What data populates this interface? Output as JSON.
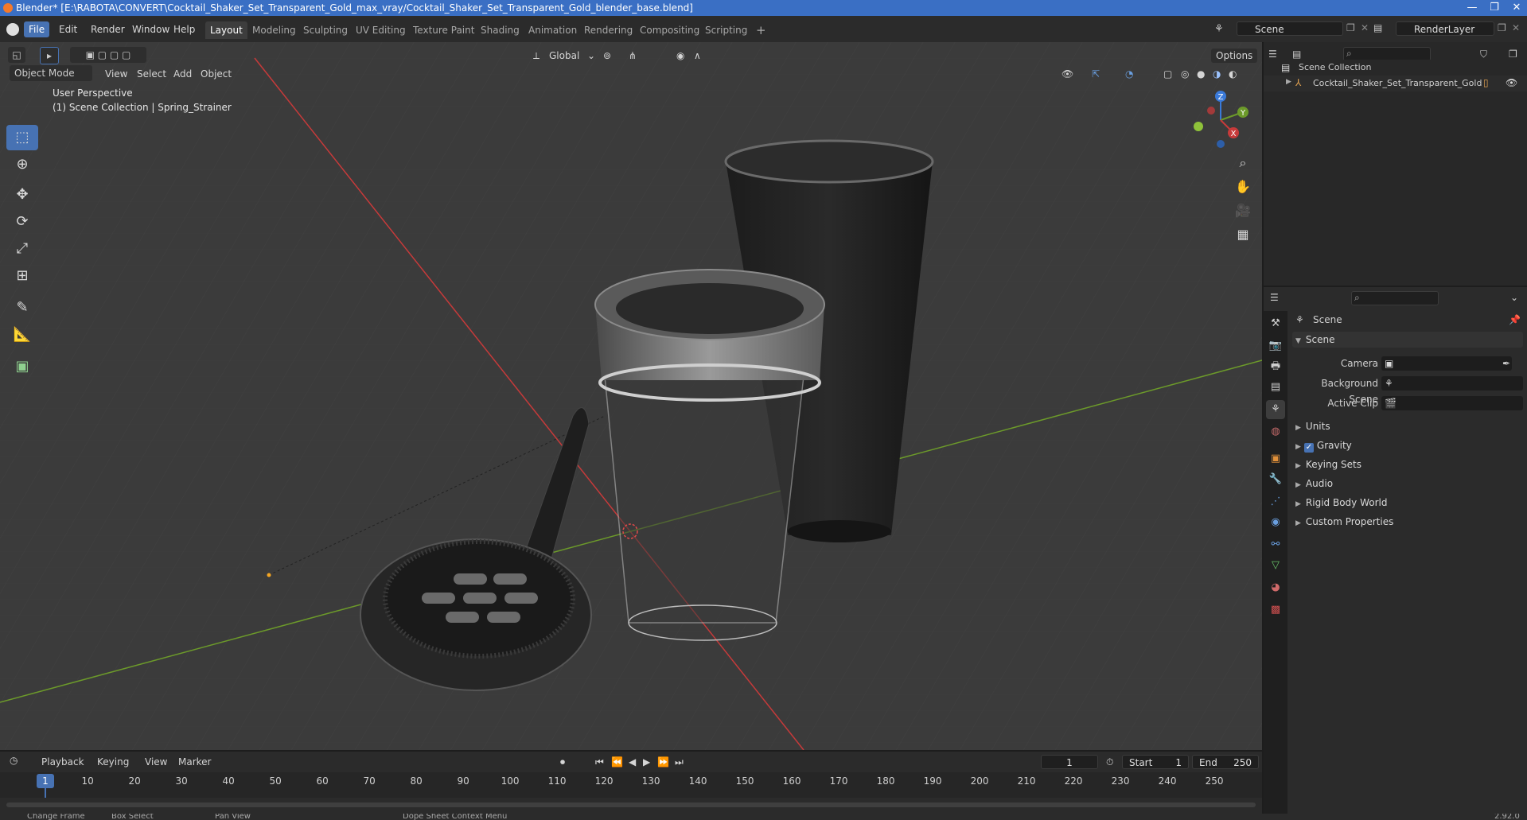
{
  "title_bar": {
    "text": "Blender* [E:\\RABOTA\\CONVERT\\Cocktail_Shaker_Set_Transparent_Gold_max_vray/Cocktail_Shaker_Set_Transparent_Gold_blender_base.blend]",
    "minimize": "—",
    "maximize": "❐",
    "close": "✕"
  },
  "menu": [
    "File",
    "Edit",
    "Render",
    "Window",
    "Help"
  ],
  "workspaces": [
    "Layout",
    "Modeling",
    "Sculpting",
    "UV Editing",
    "Texture Paint",
    "Shading",
    "Animation",
    "Rendering",
    "Compositing",
    "Scripting"
  ],
  "add_workspace": "+",
  "scene_field": "Scene",
  "renderlayer_field": "RenderLayer",
  "viewport": {
    "mode": "Object Mode",
    "menus": [
      "View",
      "Select",
      "Add",
      "Object"
    ],
    "transform_orientation": "Global",
    "options": "Options",
    "overlay_line1": "User Perspective",
    "overlay_line2": "(1) Scene Collection | Spring_Strainer",
    "gizmo_axes": {
      "x": "X",
      "y": "Y",
      "z": "Z"
    }
  },
  "outliner": {
    "root": "Scene Collection",
    "items": [
      "Cocktail_Shaker_Set_Transparent_Gold"
    ]
  },
  "properties": {
    "context": "Scene",
    "panel_title": "Scene",
    "fields": [
      {
        "label": "Camera",
        "value": ""
      },
      {
        "label": "Background Scene",
        "value": ""
      },
      {
        "label": "Active Clip",
        "value": ""
      }
    ],
    "sections": [
      "Units",
      "Gravity",
      "Keying Sets",
      "Audio",
      "Rigid Body World",
      "Custom Properties"
    ],
    "gravity_checked": true
  },
  "timeline": {
    "menus": [
      "Playback",
      "Keying",
      "View",
      "Marker"
    ],
    "current_frame": "1",
    "start_label": "Start",
    "start": "1",
    "end_label": "End",
    "end": "250",
    "ruler": [
      "1",
      "10",
      "20",
      "30",
      "40",
      "50",
      "60",
      "70",
      "80",
      "90",
      "100",
      "110",
      "120",
      "130",
      "140",
      "150",
      "160",
      "170",
      "180",
      "190",
      "200",
      "210",
      "220",
      "230",
      "240",
      "250"
    ]
  },
  "status_bar": {
    "items": [
      "Change Frame",
      "Box Select",
      "Pan View",
      "Dope Sheet Context Menu"
    ],
    "version": "2.92.0"
  },
  "colors": {
    "accent": "#4772b3",
    "viewport_bg": "#3b3b3b",
    "x_axis": "#c73a3a",
    "y_axis": "#6c9a2a",
    "z_axis": "#3a7ad9"
  }
}
